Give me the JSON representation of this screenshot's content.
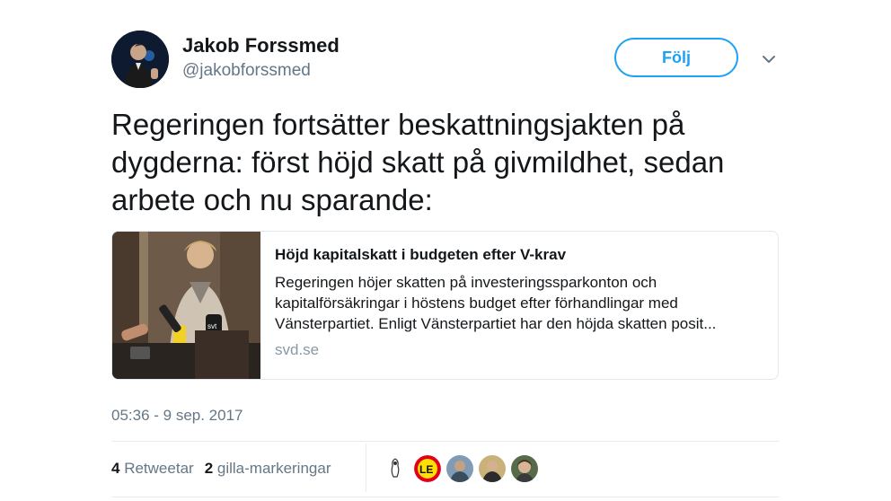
{
  "user": {
    "display_name": "Jakob Forssmed",
    "handle": "@jakobforssmed",
    "avatar_icon": "profile-photo"
  },
  "follow_label": "Följ",
  "caret_icon": "chevron-down-icon",
  "tweet": {
    "text": "Regeringen fortsätter beskattningsjakten på dygderna: först höjd skatt på givmildhet, sedan arbete och nu sparande:"
  },
  "card": {
    "title": "Höjd kapitalskatt i budgeten efter V-krav",
    "description": "Regeringen höjer skatten på investeringssparkonton och kapitalförsäkringar i höstens budget efter förhandlingar med Vänsterpartiet. Enligt Vänsterpartiet har den höjda skatten posit...",
    "domain": "svd.se",
    "image_microphone_label": "svt"
  },
  "timestamp": "05:36 - 9 sep. 2017",
  "stats": {
    "retweets_count": "4",
    "retweets_label": "Retweetar",
    "likes_count": "2",
    "likes_label": "gilla-markeringar"
  },
  "likers": [
    {
      "name": "liker-avatar-1"
    },
    {
      "name": "liker-avatar-2",
      "badge_text": "LE"
    },
    {
      "name": "liker-avatar-3"
    },
    {
      "name": "liker-avatar-4"
    },
    {
      "name": "liker-avatar-5"
    }
  ],
  "colors": {
    "accent": "#1da1f2",
    "text": "#14171a",
    "muted": "#657786",
    "border": "#e1e8ed"
  }
}
